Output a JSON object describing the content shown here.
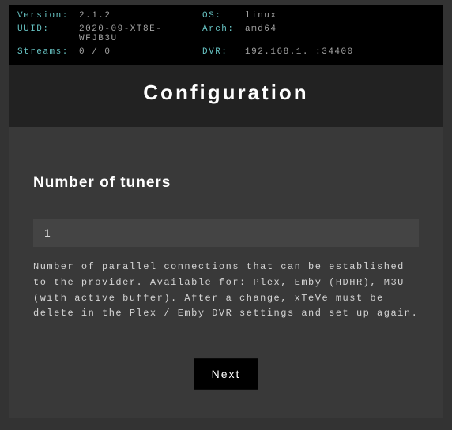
{
  "status": {
    "version_label": "Version:",
    "version_value": "2.1.2",
    "os_label": "OS:",
    "os_value": "linux",
    "uuid_label": "UUID:",
    "uuid_value": "2020-09-XT8E-WFJB3U",
    "arch_label": "Arch:",
    "arch_value": "amd64",
    "streams_label": "Streams:",
    "streams_value": "0 / 0",
    "dvr_label": "DVR:",
    "dvr_value": "192.168.1.  :34400"
  },
  "title": "Configuration",
  "form": {
    "heading": "Number of tuners",
    "tuners_value": "1",
    "description": "Number of parallel connections that can be established to the provider.\nAvailable for: Plex, Emby (HDHR), M3U (with active buffer).\nAfter a change, xTeVe must be delete in the Plex / Emby DVR settings and set up again.",
    "next_label": "Next"
  }
}
